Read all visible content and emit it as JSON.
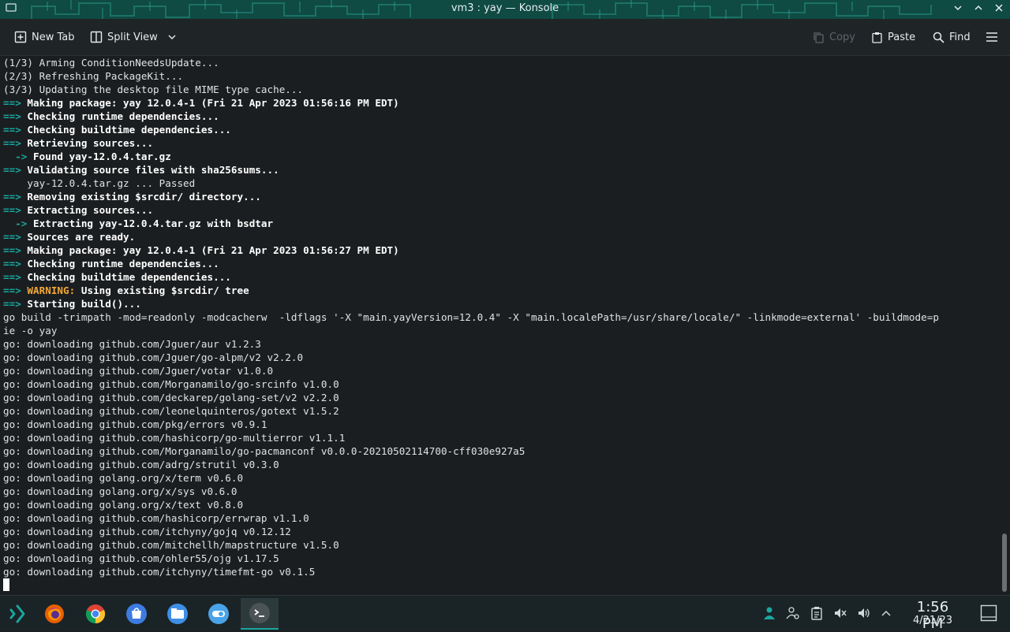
{
  "window": {
    "title": "vm3 : yay — Konsole",
    "controls": [
      "minimize-icon",
      "maximize-icon",
      "close-icon"
    ]
  },
  "toolbar": {
    "new_tab": "New Tab",
    "split_view": "Split View",
    "copy": "Copy",
    "paste": "Paste",
    "find": "Find",
    "menu_icon": "hamburger-menu-icon"
  },
  "terminal": {
    "lines": [
      "(1/3) Arming ConditionNeedsUpdate...",
      "(2/3) Refreshing PackageKit...",
      "(3/3) Updating the desktop file MIME type cache...",
      "==> Making package: yay 12.0.4-1 (Fri 21 Apr 2023 01:56:16 PM EDT)",
      "==> Checking runtime dependencies...",
      "==> Checking buildtime dependencies...",
      "==> Retrieving sources...",
      "  -> Found yay-12.0.4.tar.gz",
      "==> Validating source files with sha256sums...",
      "    yay-12.0.4.tar.gz ... Passed",
      "==> Removing existing $srcdir/ directory...",
      "==> Extracting sources...",
      "  -> Extracting yay-12.0.4.tar.gz with bsdtar",
      "==> Sources are ready.",
      "==> Making package: yay 12.0.4-1 (Fri 21 Apr 2023 01:56:27 PM EDT)",
      "==> Checking runtime dependencies...",
      "==> Checking buildtime dependencies...",
      "==> WARNING: Using existing $srcdir/ tree",
      "==> Starting build()...",
      "go build -trimpath -mod=readonly -modcacherw  -ldflags '-X \"main.yayVersion=12.0.4\" -X \"main.localePath=/usr/share/locale/\" -linkmode=external' -buildmode=p",
      "ie -o yay",
      "go: downloading github.com/Jguer/aur v1.2.3",
      "go: downloading github.com/Jguer/go-alpm/v2 v2.2.0",
      "go: downloading github.com/Jguer/votar v1.0.0",
      "go: downloading github.com/Morganamilo/go-srcinfo v1.0.0",
      "go: downloading github.com/deckarep/golang-set/v2 v2.2.0",
      "go: downloading github.com/leonelquinteros/gotext v1.5.2",
      "go: downloading github.com/pkg/errors v0.9.1",
      "go: downloading github.com/hashicorp/go-multierror v1.1.1",
      "go: downloading github.com/Morganamilo/go-pacmanconf v0.0.0-20210502114700-cff030e927a5",
      "go: downloading github.com/adrg/strutil v0.3.0",
      "go: downloading golang.org/x/term v0.6.0",
      "go: downloading golang.org/x/sys v0.6.0",
      "go: downloading golang.org/x/text v0.8.0",
      "go: downloading github.com/hashicorp/errwrap v1.1.0",
      "go: downloading github.com/itchyny/gojq v0.12.12",
      "go: downloading github.com/mitchellh/mapstructure v1.5.0",
      "go: downloading github.com/ohler55/ojg v1.17.5",
      "go: downloading github.com/itchyny/timefmt-go v0.1.5"
    ]
  },
  "taskbar": {
    "apps": [
      "application-launcher-icon",
      "firefox-icon",
      "chrome-icon",
      "discover-icon",
      "dolphin-icon",
      "settings-icon",
      "konsole-icon"
    ],
    "tray": [
      "user-icon",
      "accounts-icon",
      "clipboard-icon",
      "audio-muted-icon",
      "volume-icon",
      "expand-tray-icon"
    ],
    "time": "1:56 PM",
    "date": "4/21/23"
  },
  "colors": {
    "accent": "#1aa7a0",
    "warning": "#f2a838",
    "terminal_bg": "#1b1e20",
    "titlebar": "#0f4a43"
  }
}
